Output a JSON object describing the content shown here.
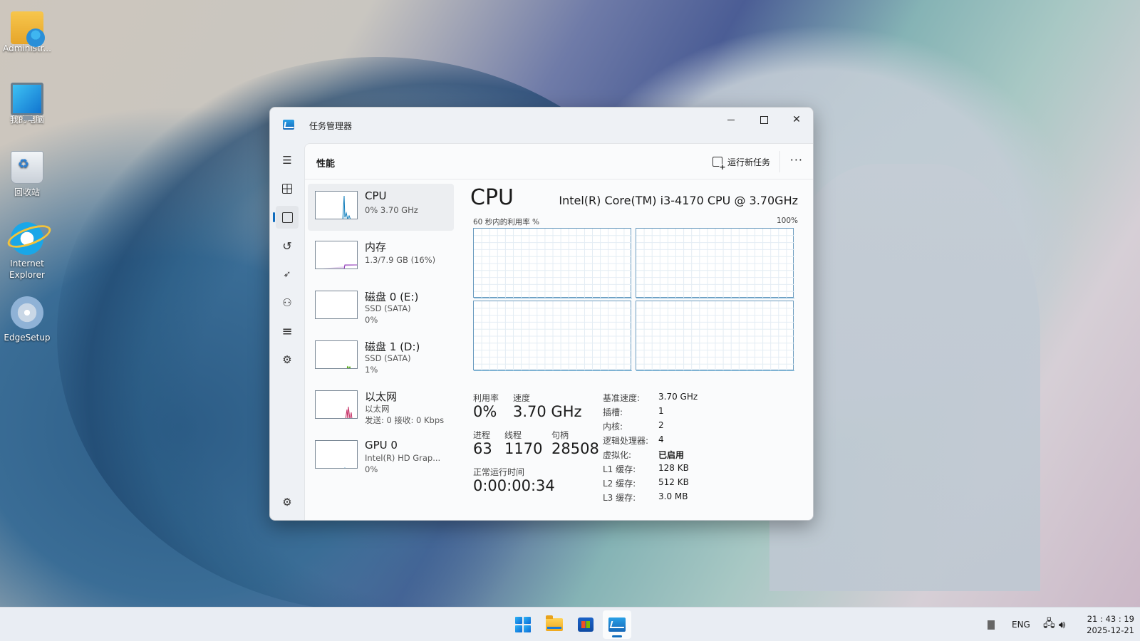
{
  "desktop": {
    "icons": [
      {
        "label": "Administr...",
        "icon": "user-folder-icon"
      },
      {
        "label": "我的电脑",
        "icon": "computer-icon"
      },
      {
        "label": "回收站",
        "icon": "recycle-bin-icon"
      },
      {
        "label": "Internet Explorer",
        "icon": "internet-explorer-icon"
      },
      {
        "label": "EdgeSetup",
        "icon": "setup-disc-icon"
      }
    ]
  },
  "window": {
    "title": "任务管理器",
    "page_title": "性能",
    "run_new_task": "运行新任务",
    "more_label": "···",
    "accent_color": "#0f6cbd",
    "graph_color": "#117dbb"
  },
  "devices": [
    {
      "name": "CPU",
      "sub1": "0% 3.70 GHz",
      "sub2": ""
    },
    {
      "name": "内存",
      "sub1": "1.3/7.9 GB (16%)",
      "sub2": ""
    },
    {
      "name": "磁盘 0 (E:)",
      "sub1": "SSD (SATA)",
      "sub2": "0%"
    },
    {
      "name": "磁盘 1 (D:)",
      "sub1": "SSD (SATA)",
      "sub2": "1%"
    },
    {
      "name": "以太网",
      "sub1": "以太网",
      "sub2": "发送: 0 接收: 0 Kbps"
    },
    {
      "name": "GPU 0",
      "sub1": "Intel(R) HD Grap...",
      "sub2": "0%"
    }
  ],
  "cpu": {
    "title": "CPU",
    "model": "Intel(R) Core(TM) i3-4170 CPU @ 3.70GHz",
    "util_label": "60 秒内的利用率 %",
    "util_max": "100%",
    "stats": {
      "utilization_label": "利用率",
      "utilization": "0%",
      "speed_label": "速度",
      "speed": "3.70 GHz",
      "processes_label": "进程",
      "processes": "63",
      "threads_label": "线程",
      "threads": "1170",
      "handles_label": "句柄",
      "handles": "28508",
      "uptime_label": "正常运行时间",
      "uptime": "0:00:00:34"
    },
    "info": [
      {
        "key": "基准速度:",
        "value": "3.70 GHz"
      },
      {
        "key": "插槽:",
        "value": "1"
      },
      {
        "key": "内核:",
        "value": "2"
      },
      {
        "key": "逻辑处理器:",
        "value": "4"
      },
      {
        "key": "虚拟化:",
        "value": "已启用"
      },
      {
        "key": "L1 缓存:",
        "value": "128 KB"
      },
      {
        "key": "L2 缓存:",
        "value": "512 KB"
      },
      {
        "key": "L3 缓存:",
        "value": "3.0 MB"
      }
    ]
  },
  "chart_data": {
    "type": "area",
    "title": "60 秒内的利用率 %",
    "ylim": [
      0,
      100
    ],
    "x": [
      0,
      1,
      2,
      3,
      4,
      5,
      6,
      7,
      8,
      9,
      10,
      11,
      12,
      13,
      14,
      15,
      16,
      17,
      18,
      19,
      20,
      21,
      22,
      23,
      24,
      25,
      26,
      27,
      28,
      29,
      30,
      31,
      32,
      33,
      34,
      35,
      36,
      37,
      38,
      39,
      40,
      41,
      42,
      43,
      44,
      45,
      46,
      47,
      48,
      49,
      50,
      51,
      52,
      53,
      54,
      55,
      56,
      57,
      58,
      59,
      60
    ],
    "series": [
      {
        "values": [
          0,
          0,
          0,
          0,
          0,
          0,
          0,
          0,
          0,
          0,
          0,
          0,
          0,
          0,
          0,
          0,
          0,
          0,
          0,
          0,
          0,
          0,
          0,
          0,
          0,
          0,
          0,
          0,
          0,
          0,
          0,
          0,
          0,
          0,
          0,
          0,
          0,
          0,
          0,
          0,
          0,
          0,
          0,
          0,
          0,
          0,
          0,
          0,
          0,
          0,
          0,
          0,
          0,
          0,
          0,
          0,
          0,
          0,
          0,
          0,
          0
        ]
      },
      {
        "values": [
          0,
          0,
          0,
          0,
          0,
          0,
          0,
          0,
          0,
          0,
          0,
          0,
          0,
          0,
          0,
          0,
          0,
          0,
          0,
          0,
          0,
          0,
          0,
          0,
          0,
          0,
          0,
          0,
          0,
          0,
          0,
          0,
          0,
          0,
          0,
          0,
          0,
          0,
          0,
          0,
          0,
          0,
          0,
          0,
          0,
          0,
          0,
          0,
          0,
          0,
          0,
          0,
          0,
          0,
          0,
          0,
          0,
          0,
          0,
          0,
          0
        ]
      },
      {
        "values": [
          0,
          0,
          0,
          0,
          0,
          0,
          0,
          0,
          0,
          0,
          0,
          0,
          0,
          0,
          0,
          0,
          0,
          0,
          0,
          0,
          0,
          0,
          0,
          0,
          0,
          0,
          0,
          0,
          0,
          0,
          0,
          0,
          0,
          0,
          0,
          0,
          0,
          0,
          0,
          0,
          0,
          0,
          0,
          0,
          0,
          0,
          0,
          0,
          0,
          0,
          0,
          0,
          0,
          0,
          0,
          0,
          0,
          0,
          0,
          0,
          0
        ]
      },
      {
        "values": [
          0,
          0,
          0,
          0,
          0,
          0,
          0,
          0,
          0,
          0,
          0,
          0,
          0,
          0,
          0,
          0,
          0,
          0,
          0,
          0,
          0,
          0,
          0,
          0,
          0,
          0,
          0,
          0,
          0,
          0,
          0,
          0,
          0,
          0,
          0,
          0,
          0,
          0,
          0,
          0,
          0,
          0,
          0,
          0,
          0,
          0,
          0,
          0,
          0,
          0,
          0,
          0,
          0,
          0,
          0,
          0,
          0,
          0,
          0,
          0,
          0
        ]
      }
    ]
  },
  "taskbar": {
    "apps": [
      "start-icon",
      "file-explorer-icon",
      "store-icon",
      "task-manager-icon"
    ],
    "lang": "ENG",
    "time": "21 : 43 : 19",
    "date": "2025-12-21"
  }
}
